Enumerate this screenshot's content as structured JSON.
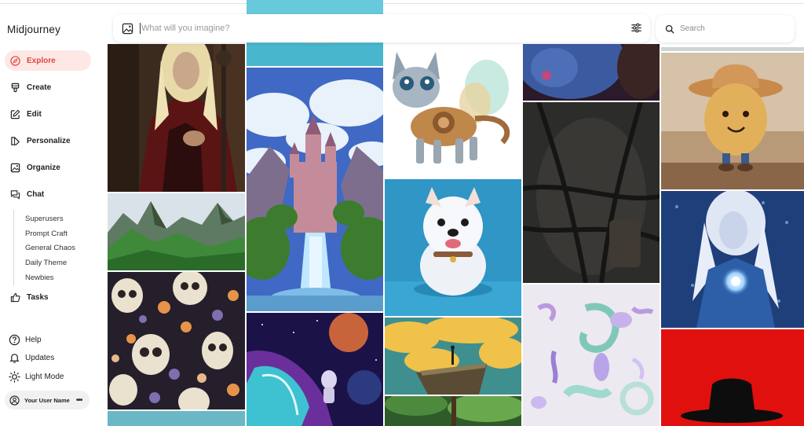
{
  "app": {
    "title": "Midjourney"
  },
  "sidebar": {
    "nav": [
      {
        "label": "Explore",
        "icon": "compass-icon",
        "active": true
      },
      {
        "label": "Create",
        "icon": "brush-icon",
        "active": false
      },
      {
        "label": "Edit",
        "icon": "edit-icon",
        "active": false
      },
      {
        "label": "Personalize",
        "icon": "palette-icon",
        "active": false
      },
      {
        "label": "Organize",
        "icon": "image-icon",
        "active": false
      },
      {
        "label": "Chat",
        "icon": "chat-icon",
        "active": false
      }
    ],
    "chat_rooms": [
      "Superusers",
      "Prompt Craft",
      "General Chaos",
      "Daily Theme",
      "Newbies"
    ],
    "tasks": {
      "label": "Tasks",
      "icon": "thumbs-up-icon"
    },
    "bottom": [
      {
        "label": "Help",
        "icon": "help-icon"
      },
      {
        "label": "Updates",
        "icon": "bell-icon"
      },
      {
        "label": "Light Mode",
        "icon": "sun-icon"
      }
    ],
    "user": {
      "name": "Your User Name",
      "menu": "•••"
    }
  },
  "imagine": {
    "placeholder": "What will you imagine?",
    "value": ""
  },
  "search": {
    "placeholder": "Search",
    "value": ""
  },
  "colors": {
    "accent": "#e0453a",
    "accent_bg": "#fde8e6"
  },
  "gallery": {
    "images": [
      "blond-warrior-with-staff",
      "green-mountain-valley",
      "skulls-and-flowers-pattern",
      "turquoise-sky-strip",
      "pixel-art-castle-waterfall",
      "astronaut-surfing-cosmic-wave",
      "mechanical-winged-cat-sticker",
      "white-terrier-puppy",
      "figure-on-cliff-golden-clouds",
      "forest-canopy",
      "blue-scaled-creature-closeup",
      "hands-in-chains",
      "pastel-3d-shapes",
      "frosted-branches",
      "potato-cowboy-character",
      "ice-elf-with-glowing-orb",
      "black-hat-on-red"
    ]
  }
}
